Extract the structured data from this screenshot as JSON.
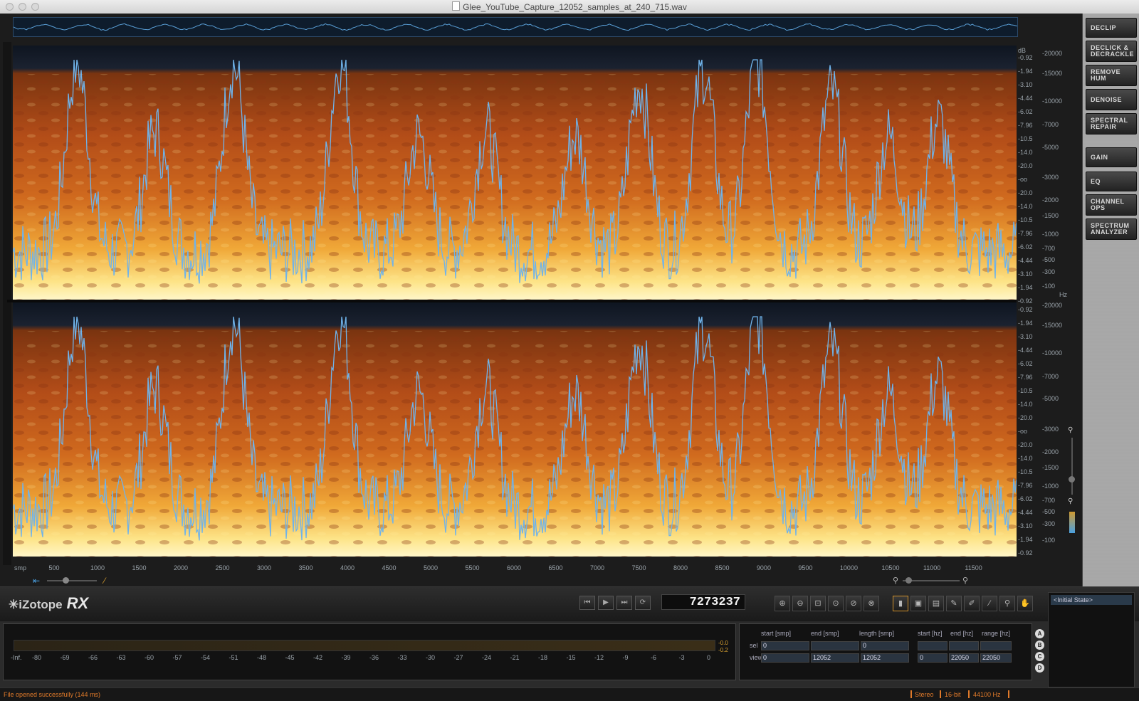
{
  "window": {
    "title": "Glee_YouTube_Capture_12052_samples_at_240_715.wav"
  },
  "db_ticks": [
    "dB",
    "-0.92",
    "-1.94",
    "-3.10",
    "-4.44",
    "-6.02",
    "-7.96",
    "-10.5",
    "-14.0",
    "-20.0",
    "-oo",
    "-20.0",
    "-14.0",
    "-10.5",
    "-7.96",
    "-6.02",
    "-4.44",
    "-3.10",
    "-1.94",
    "-0.92"
  ],
  "db_ticks_bottom": [
    "-0.92",
    "-1.94",
    "-3.10",
    "-4.44",
    "-6.02",
    "-7.96",
    "-10.5",
    "-14.0",
    "-20.0",
    "-oo",
    "-20.0",
    "-14.0",
    "-10.5",
    "-7.96",
    "-6.02",
    "-4.44",
    "-3.10",
    "-1.94",
    "-0.92"
  ],
  "hz_ticks_top": [
    "-20000",
    "-15000",
    "-10000",
    "-7000",
    "-5000",
    "-3000",
    "-2000",
    "-1500",
    "-1000",
    "-700",
    "-500",
    "-300",
    "-100",
    "Hz"
  ],
  "hz_ticks_bottom": [
    "-20000",
    "-15000",
    "-10000",
    "-7000",
    "-5000",
    "-3000",
    "-2000",
    "-1500",
    "-1000",
    "-700",
    "-500",
    "-300",
    "-100"
  ],
  "x_axis": {
    "unit": "smp",
    "ticks": [
      "500",
      "1000",
      "1500",
      "2000",
      "2500",
      "3000",
      "3500",
      "4000",
      "4500",
      "5000",
      "5500",
      "6000",
      "6500",
      "7000",
      "7500",
      "8000",
      "8500",
      "9000",
      "9500",
      "10000",
      "10500",
      "11000",
      "11500"
    ]
  },
  "modules": [
    "DECLIP",
    "DECLICK & DECRACKLE",
    "REMOVE HUM",
    "DENOISE",
    "SPECTRAL REPAIR",
    "GAIN",
    "EQ",
    "CHANNEL OPS",
    "SPECTRUM ANALYZER"
  ],
  "transport": {
    "logo_text": "iZotope",
    "logo_product": "RX",
    "timecode": "7273237",
    "buttons": [
      "⏮",
      "▶",
      "⏭",
      "⟳"
    ]
  },
  "tools": [
    "zoom-in",
    "zoom-out",
    "zoom-fit",
    "zoom-sel",
    "zoom-time",
    "zoom-freq",
    "time-select",
    "rect-select",
    "freq-select",
    "lasso",
    "brush",
    "wand",
    "magnify",
    "hand"
  ],
  "history": {
    "initial_state": "<Initial State>"
  },
  "meter": {
    "scale": [
      "-Inf.",
      "-80",
      "-69",
      "-66",
      "-63",
      "-60",
      "-57",
      "-54",
      "-51",
      "-48",
      "-45",
      "-42",
      "-39",
      "-36",
      "-33",
      "-30",
      "-27",
      "-24",
      "-21",
      "-18",
      "-15",
      "-12",
      "-9",
      "-6",
      "-3",
      "0"
    ],
    "peak_top": "-0.0",
    "peak_bottom": "-0.2"
  },
  "selection": {
    "headers": [
      "start [smp]",
      "end [smp]",
      "length [smp]",
      "start [hz]",
      "end [hz]",
      "range [hz]"
    ],
    "sel_label": "sel",
    "view_label": "view",
    "sel": [
      "0",
      "",
      "0",
      "",
      "",
      ""
    ],
    "view": [
      "0",
      "12052",
      "12052",
      "0",
      "22050",
      "22050"
    ]
  },
  "abcd": [
    "A",
    "B",
    "C",
    "D"
  ],
  "status": {
    "message": "File opened successfully (144 ms)",
    "channels": "Stereo",
    "bit_depth": "16-bit",
    "sample_rate": "44100 Hz"
  },
  "colors": {
    "accent": "#e07a2a",
    "waveform": "#6fb3ea",
    "spectrogram_low": "#fff5b0",
    "spectrogram_high": "#b8461a"
  }
}
